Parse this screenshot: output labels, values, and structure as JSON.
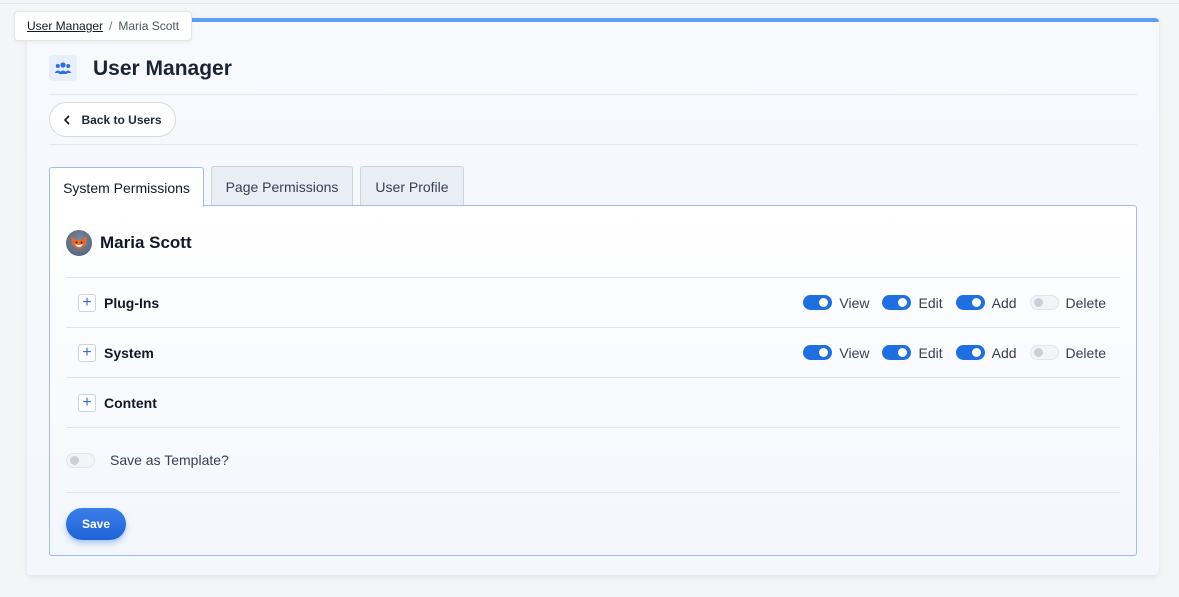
{
  "breadcrumb": {
    "root": "User Manager",
    "separator": "/",
    "current": "Maria Scott"
  },
  "header": {
    "title": "User Manager",
    "icon": "users-icon"
  },
  "back_button": {
    "label": "Back to Users",
    "icon": "chevron-left-icon"
  },
  "tabs": [
    {
      "label": "System Permissions",
      "active": true
    },
    {
      "label": "Page Permissions",
      "active": false
    },
    {
      "label": "User Profile",
      "active": false
    }
  ],
  "user": {
    "name": "Maria Scott",
    "avatar": "fox-avatar"
  },
  "permissions": [
    {
      "label": "Plug-Ins",
      "toggles": [
        {
          "label": "View",
          "on": true
        },
        {
          "label": "Edit",
          "on": true
        },
        {
          "label": "Add",
          "on": true
        },
        {
          "label": "Delete",
          "on": false
        }
      ]
    },
    {
      "label": "System",
      "toggles": [
        {
          "label": "View",
          "on": true
        },
        {
          "label": "Edit",
          "on": true
        },
        {
          "label": "Add",
          "on": true
        },
        {
          "label": "Delete",
          "on": false
        }
      ]
    },
    {
      "label": "Content",
      "toggles": []
    }
  ],
  "save_template": {
    "label": "Save as Template?",
    "on": false
  },
  "save_button": {
    "label": "Save"
  },
  "colors": {
    "accent": "#1f6fe0",
    "topbar": "#5e9ef5"
  }
}
